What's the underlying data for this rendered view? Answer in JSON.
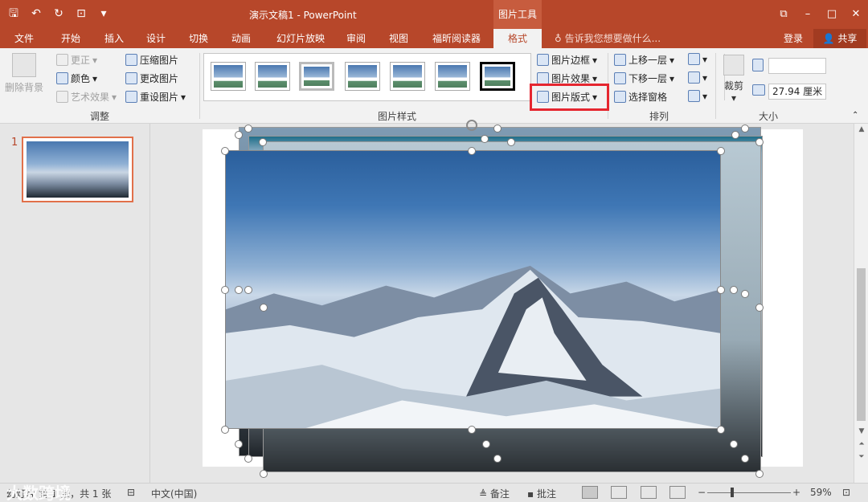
{
  "titlebar": {
    "doc_title": "演示文稿1 - PowerPoint",
    "context_tool": "图片工具",
    "qat": [
      "save-icon",
      "undo-icon",
      "redo-icon",
      "present-icon",
      "customize-icon"
    ]
  },
  "tabs": [
    "文件",
    "开始",
    "插入",
    "设计",
    "切换",
    "动画",
    "幻灯片放映",
    "审阅",
    "视图",
    "福昕阅读器",
    "格式"
  ],
  "tell_me": "告诉我您想要做什么...",
  "account": {
    "login": "登录",
    "share": "共享"
  },
  "ribbon": {
    "adjust": {
      "label": "调整",
      "remove_bg": "删除背景",
      "corrections": "更正",
      "color": "颜色",
      "artistic": "艺术效果",
      "compress": "压缩图片",
      "change": "更改图片",
      "reset": "重设图片"
    },
    "styles": {
      "label": "图片样式",
      "border": "图片边框",
      "effects": "图片效果",
      "layout": "图片版式"
    },
    "arrange": {
      "label": "排列",
      "forward": "上移一层",
      "backward": "下移一层",
      "selection_pane": "选择窗格"
    },
    "size": {
      "label": "大小",
      "crop": "裁剪",
      "height": "",
      "width": "27.94 厘米"
    }
  },
  "slides": {
    "number": "1"
  },
  "status": {
    "slide_info": "幻灯片 第 1 张，共 1 张",
    "language": "中文(中国)",
    "notes": "备注",
    "comments": "批注",
    "zoom": "59%",
    "watermark": "大数跨境"
  },
  "colors": {
    "accent": "#b7472a",
    "highlight": "#e5262f"
  }
}
